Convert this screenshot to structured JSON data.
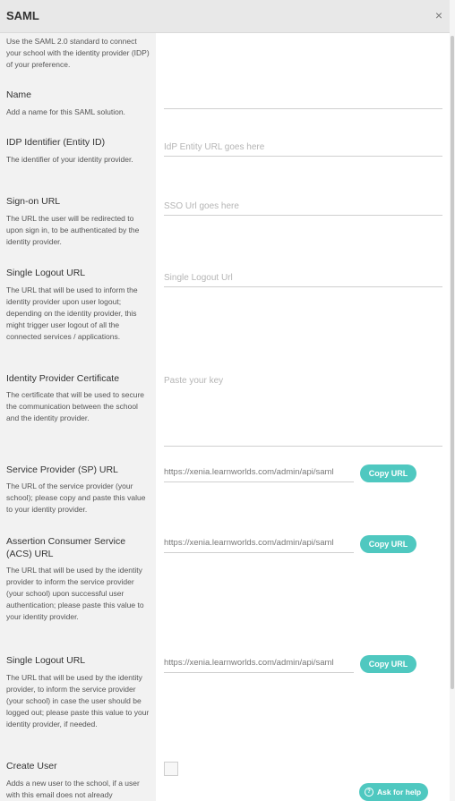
{
  "header": {
    "title": "SAML",
    "close_icon": "×"
  },
  "intro": "Use the SAML 2.0 standard to connect your school with the identity provider (IDP) of your preference.",
  "fields": {
    "name": {
      "title": "Name",
      "desc": "Add a name for this SAML solution.",
      "value": ""
    },
    "idp_identifier": {
      "title": "IDP Identifier (Entity ID)",
      "desc": "The identifier of your identity provider.",
      "placeholder": "IdP Entity URL goes here"
    },
    "sign_on_url": {
      "title": "Sign-on URL",
      "desc": "The URL the user will be redirected to upon sign in, to be authenticated by the identity provider.",
      "placeholder": "SSO Url goes here"
    },
    "single_logout_url": {
      "title": "Single Logout URL",
      "desc": "The URL that will be used to inform the identity provider upon user logout; depending on the identity provider, this might trigger user logout of all the connected services / applications.",
      "placeholder": "Single Logout Url"
    },
    "idp_certificate": {
      "title": "Identity Provider Certificate",
      "desc": "The certificate that will be used to secure the communication between the school and the identity provider.",
      "placeholder": "Paste your key"
    },
    "sp_url": {
      "title": "Service Provider (SP) URL",
      "desc": "The URL of the service provider (your school); please copy and paste this value to your identity provider.",
      "value": "https://xenia.learnworlds.com/admin/api/saml",
      "button": "Copy URL"
    },
    "acs_url": {
      "title": "Assertion Consumer Service (ACS) URL",
      "desc": "The URL that will be used by the identity provider to inform the service provider (your school) upon successful user authentication; please paste this value to your identity provider.",
      "value": "https://xenia.learnworlds.com/admin/api/saml",
      "button": "Copy URL"
    },
    "sp_logout_url": {
      "title": "Single Logout URL",
      "desc": "The URL that will be used by the identity provider, to inform the service provider (your school) in case the user should be logged out; please paste this value to your identity provider, if needed.",
      "value": "https://xenia.learnworlds.com/admin/api/saml",
      "button": "Copy URL"
    },
    "create_user": {
      "title": "Create User",
      "desc": "Adds a new user to the school, if a user with this email does not already"
    }
  },
  "help": {
    "label": "Ask for help",
    "icon": "?"
  },
  "colors": {
    "accent": "#4fc8c0",
    "header_bg": "#e8e8e8",
    "left_bg": "#f2f2f2"
  }
}
